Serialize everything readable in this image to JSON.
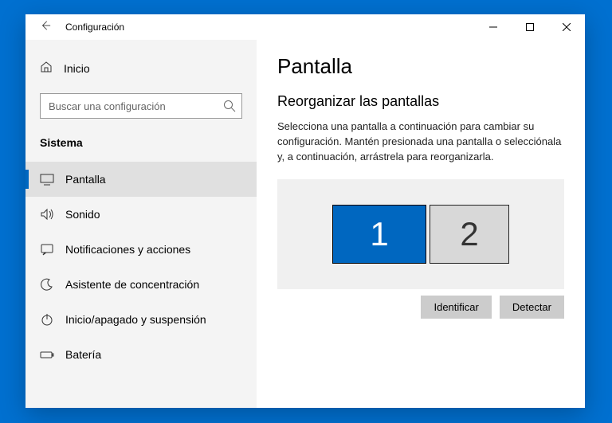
{
  "header": {
    "app_title": "Configuración"
  },
  "home": {
    "label": "Inicio"
  },
  "search": {
    "placeholder": "Buscar una configuración"
  },
  "section": {
    "title": "Sistema"
  },
  "nav": {
    "items": [
      {
        "label": "Pantalla"
      },
      {
        "label": "Sonido"
      },
      {
        "label": "Notificaciones y acciones"
      },
      {
        "label": "Asistente de concentración"
      },
      {
        "label": "Inicio/apagado y suspensión"
      },
      {
        "label": "Batería"
      }
    ]
  },
  "main": {
    "title": "Pantalla",
    "subtitle": "Reorganizar las pantallas",
    "description": "Selecciona una pantalla a continuación para cambiar su configuración. Mantén presionada una pantalla o selecciónala y, a continuación, arrástrela para reorganizarla.",
    "monitors": [
      {
        "label": "1",
        "selected": true
      },
      {
        "label": "2",
        "selected": false
      }
    ],
    "actions": {
      "identify": "Identificar",
      "detect": "Detectar"
    }
  }
}
